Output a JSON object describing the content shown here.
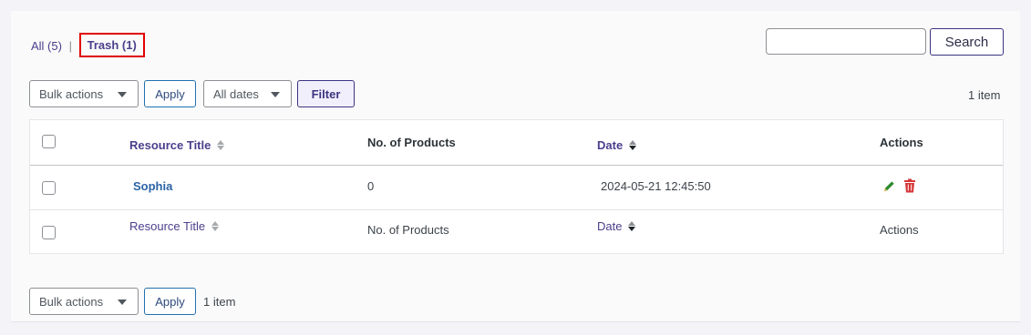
{
  "views": {
    "all_label": "All (5)",
    "separator": "|",
    "trash_label": "Trash (1)"
  },
  "search": {
    "button_label": "Search",
    "value": ""
  },
  "top_nav": {
    "bulk_actions": "Bulk actions",
    "apply_label": "Apply",
    "dates": "All dates",
    "filter_label": "Filter",
    "item_count": "1 item"
  },
  "table": {
    "columns": [
      "Resource Title",
      "No. of Products",
      "Date",
      "Actions"
    ],
    "rows": [
      {
        "title": "Sophia",
        "products": "0",
        "date": "2024-05-21 12:45:50"
      }
    ]
  },
  "bottom_nav": {
    "bulk_actions": "Bulk actions",
    "apply_label": "Apply",
    "item_count": "1 item"
  },
  "colors": {
    "accent": "#3b3480",
    "edit": "#2e8b2e",
    "delete": "#d63638",
    "highlight_box": "#e10000"
  },
  "icons": {
    "edit": "pencil-icon",
    "delete": "trash-icon"
  }
}
